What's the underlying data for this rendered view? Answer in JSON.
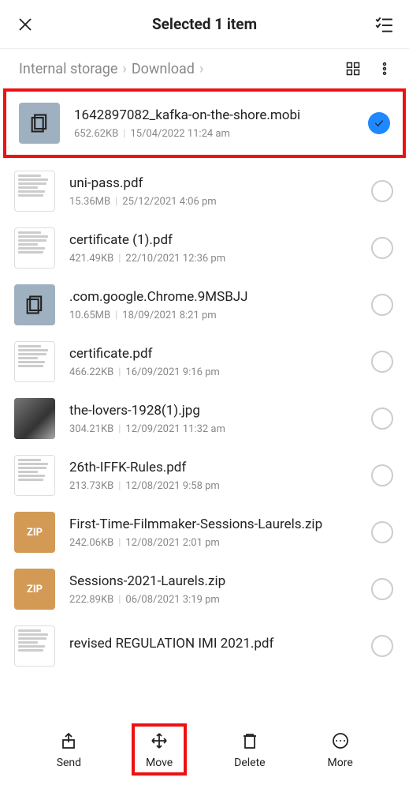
{
  "header": {
    "title": "Selected 1 item"
  },
  "breadcrumb": {
    "root": "Internal storage",
    "current": "Download"
  },
  "files": [
    {
      "name": "1642897082_kafka-on-the-shore.mobi",
      "size": "652.62KB",
      "date": "15/04/2022 11:24 am",
      "thumb": "doc",
      "selected": true
    },
    {
      "name": "uni-pass.pdf",
      "size": "15.36MB",
      "date": "25/12/2021 4:06 pm",
      "thumb": "pdf",
      "selected": false
    },
    {
      "name": "certificate (1).pdf",
      "size": "421.49KB",
      "date": "22/10/2021 12:36 pm",
      "thumb": "pdf",
      "selected": false
    },
    {
      "name": ".com.google.Chrome.9MSBJJ",
      "size": "10.65MB",
      "date": "18/09/2021 8:21 pm",
      "thumb": "doc",
      "selected": false
    },
    {
      "name": "certificate.pdf",
      "size": "466.22KB",
      "date": "16/09/2021 9:16 pm",
      "thumb": "pdf",
      "selected": false
    },
    {
      "name": "the-lovers-1928(1).jpg",
      "size": "304.21KB",
      "date": "12/09/2021 11:32 am",
      "thumb": "img",
      "selected": false
    },
    {
      "name": "26th-IFFK-Rules.pdf",
      "size": "213.73KB",
      "date": "12/08/2021 9:58 pm",
      "thumb": "pdf",
      "selected": false
    },
    {
      "name": "First-Time-Filmmaker-Sessions-Laurels.zip",
      "size": "242.06KB",
      "date": "12/08/2021 2:01 pm",
      "thumb": "zip",
      "selected": false
    },
    {
      "name": "Sessions-2021-Laurels.zip",
      "size": "222.89KB",
      "date": "06/08/2021 3:19 pm",
      "thumb": "zip",
      "selected": false
    },
    {
      "name": "revised REGULATION IMI 2021.pdf",
      "size": "",
      "date": "",
      "thumb": "pdf",
      "selected": false
    }
  ],
  "thumb_labels": {
    "zip": "ZIP"
  },
  "actions": {
    "send": "Send",
    "move": "Move",
    "delete": "Delete",
    "more": "More"
  }
}
